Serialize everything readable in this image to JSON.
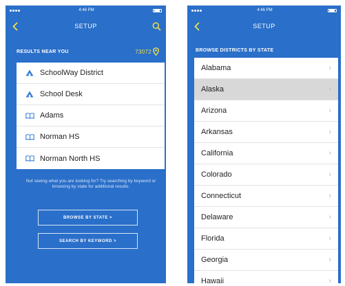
{
  "left_screen": {
    "status": {
      "time": "4:46 PM"
    },
    "nav": {
      "title": "SETUP"
    },
    "section": {
      "label": "RESULTS NEAR YOU",
      "zip": "73072"
    },
    "results": [
      {
        "label": "SchoolWay District",
        "icon": "district-icon"
      },
      {
        "label": "School Desk",
        "icon": "district-icon"
      },
      {
        "label": "Adams",
        "icon": "book-icon"
      },
      {
        "label": "Norman HS",
        "icon": "book-icon"
      },
      {
        "label": "Norman North HS",
        "icon": "book-icon"
      }
    ],
    "note": "Not seeing what you are looking for? Try searching by keyword or browsing by state for additional results.",
    "buttons": {
      "browse": "BROWSE BY STATE >",
      "keyword": "SEARCH BY KEYWORD >"
    }
  },
  "right_screen": {
    "status": {
      "time": "4:46 PM"
    },
    "nav": {
      "title": "SETUP"
    },
    "section": {
      "label": "BROWSE DISTRICTS BY STATE"
    },
    "states": [
      "Alabama",
      "Alaska",
      "Arizona",
      "Arkansas",
      "California",
      "Colorado",
      "Connecticut",
      "Delaware",
      "Florida",
      "Georgia",
      "Hawaii"
    ],
    "selected_state": "Alaska"
  },
  "colors": {
    "background": "#2a6fc9",
    "accent": "#f2e34b",
    "list_bg": "#ffffff",
    "selected_row": "#d8d8d8"
  }
}
